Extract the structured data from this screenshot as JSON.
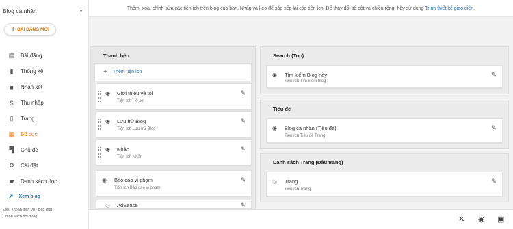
{
  "sidebar": {
    "blog_name": "Blog cá nhân",
    "new_post": "BÀI ĐĂNG MỚI",
    "items": [
      {
        "label": "Bài đăng",
        "icon": "posts-icon"
      },
      {
        "label": "Thống kê",
        "icon": "stats-icon"
      },
      {
        "label": "Nhận xét",
        "icon": "comments-icon"
      },
      {
        "label": "Thu nhập",
        "icon": "earnings-icon"
      },
      {
        "label": "Trang",
        "icon": "pages-icon"
      },
      {
        "label": "Bố cục",
        "icon": "layout-icon",
        "active": true
      },
      {
        "label": "Chủ đề",
        "icon": "theme-icon"
      },
      {
        "label": "Cài đặt",
        "icon": "settings-icon"
      },
      {
        "label": "Danh sách đọc",
        "icon": "reading-list-icon"
      }
    ],
    "view_blog": "Xem blog",
    "footer_terms": "Điều khoản dịch vụ",
    "footer_sep": "·",
    "footer_privacy": "Bảo mật",
    "footer_content": "Chính sách nội dung"
  },
  "info": {
    "text": "Thêm, xóa, chỉnh sửa các tiện ích trên blog của bạn. Nhấp và kéo để sắp xếp lại các tiện ích. Để thay đổi số cột và chiều rộng, hãy sử dụng",
    "link": "Trình thiết kế giao diện."
  },
  "left_column": {
    "title": "Thanh bên",
    "add_widget": "Thêm tiện ích",
    "widgets": [
      {
        "title": "Giới thiệu về tôi",
        "sub": "Tiện ích Hồ sơ"
      },
      {
        "title": "Lưu trữ Blog",
        "sub": "Tiện ích Lưu trữ Blog"
      },
      {
        "title": "Nhãn",
        "sub": "Tiện ích Nhãn"
      },
      {
        "title": "Báo cáo vi phạm",
        "sub": "Tiện ích Báo cáo vi phạm"
      },
      {
        "title": "AdSense",
        "sub": ""
      }
    ]
  },
  "right_sections": [
    {
      "title": "Search (Top)",
      "widget_title": "Tìm kiếm Blog này",
      "widget_sub": "Tiện ích Tìm kiếm blog"
    },
    {
      "title": "Tiêu đề",
      "widget_title": "Blog cá nhân (Tiêu đề)",
      "widget_sub": "Tiện ích Tiêu đề Trang"
    },
    {
      "title": "Danh sách Trang (Đầu trang)",
      "widget_title": "Trang",
      "widget_sub": "Tiện ích Trang"
    }
  ],
  "colors": {
    "accent": "#e67700",
    "link": "#2b6cb0"
  }
}
